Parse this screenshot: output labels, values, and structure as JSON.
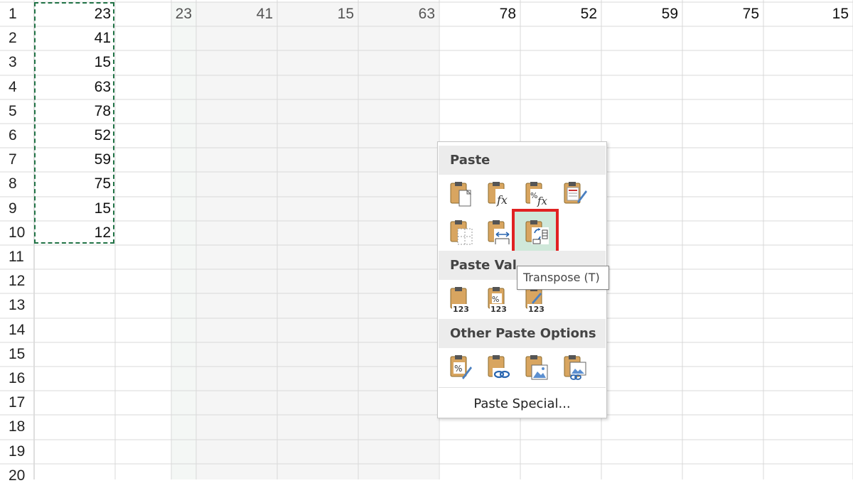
{
  "sheet": {
    "row_numbers": [
      "1",
      "2",
      "3",
      "4",
      "5",
      "6",
      "7",
      "8",
      "9",
      "10",
      "11",
      "12",
      "13",
      "14",
      "15",
      "16",
      "17",
      "18",
      "19",
      "20"
    ],
    "column_a": [
      "23",
      "41",
      "15",
      "63",
      "78",
      "52",
      "59",
      "75",
      "15",
      "12"
    ],
    "row_1": [
      "23",
      "41",
      "15",
      "63",
      "78",
      "52",
      "59",
      "75",
      "15"
    ]
  },
  "menu": {
    "paste_header": "Paste",
    "paste_values_header": "Paste Val",
    "other_header": "Other Paste Options",
    "paste_special": "Paste Special...",
    "tooltip": "Transpose (T)",
    "icons_row1": [
      "paste-icon",
      "paste-formulas-icon",
      "paste-formulas-number-format-icon",
      "keep-source-formatting-icon"
    ],
    "icons_row2": [
      "no-borders-icon",
      "keep-column-widths-icon",
      "transpose-icon"
    ],
    "values_icons": [
      "paste-values-icon",
      "values-number-format-icon",
      "values-source-formatting-icon"
    ],
    "values_icon_label": "123",
    "other_icons": [
      "formatting-icon",
      "paste-link-icon",
      "picture-icon",
      "linked-picture-icon"
    ]
  },
  "colors": {
    "highlight_border": "#e02222",
    "highlight_fill": "#cfe8da",
    "marquee": "#217346"
  }
}
